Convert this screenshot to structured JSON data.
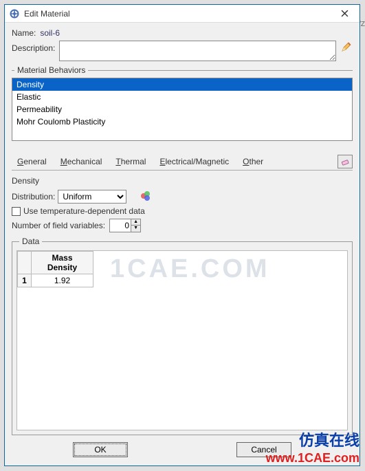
{
  "window": {
    "title": "Edit Material"
  },
  "fields": {
    "name_label": "Name:",
    "name_value": "soil-6",
    "description_label": "Description:",
    "description_value": ""
  },
  "behaviors": {
    "legend": "Material Behaviors",
    "items": [
      {
        "label": "Density",
        "selected": true
      },
      {
        "label": "Elastic",
        "selected": false
      },
      {
        "label": "Permeability",
        "selected": false
      },
      {
        "label": "Mohr Coulomb Plasticity",
        "selected": false
      }
    ]
  },
  "tabs": {
    "general": "General",
    "mechanical": "Mechanical",
    "thermal": "Thermal",
    "electrical": "Electrical/Magnetic",
    "other": "Other"
  },
  "density": {
    "header": "Density",
    "distribution_label": "Distribution:",
    "distribution_value": "Uniform",
    "temp_dep_label": "Use temperature-dependent data",
    "temp_dep_checked": false,
    "nfv_label": "Number of field variables:",
    "nfv_value": "0"
  },
  "data": {
    "legend": "Data",
    "columns": [
      "Mass\nDensity"
    ],
    "rows": [
      {
        "n": "1",
        "values": [
          "1.92"
        ]
      }
    ]
  },
  "buttons": {
    "ok": "OK",
    "cancel": "Cancel"
  },
  "watermarks": {
    "site": "1CAE.COM",
    "blue": "仿真在线",
    "red": "www.1CAE.com"
  },
  "bg": {
    "side": "/Z"
  }
}
